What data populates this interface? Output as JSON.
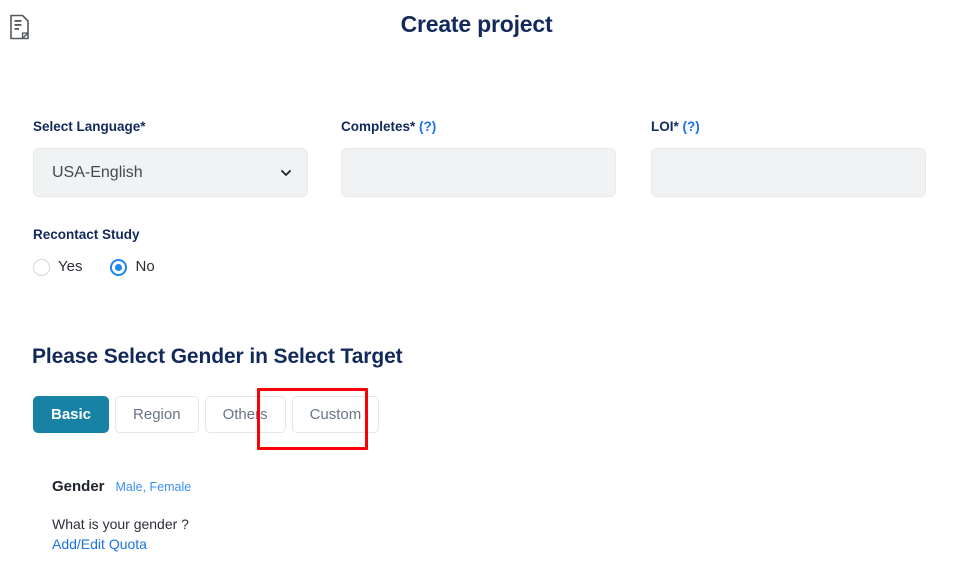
{
  "header": {
    "icon": "document-edit-icon",
    "title": "Create project"
  },
  "form": {
    "language": {
      "label": "Select Language*",
      "value": "USA-English",
      "chevron": "chevron-down-icon"
    },
    "completes": {
      "label": "Completes*",
      "help": "(?)",
      "value": "",
      "placeholder": ""
    },
    "loi": {
      "label": "LOI*",
      "help": "(?)",
      "value": "",
      "placeholder": ""
    },
    "recontact": {
      "label": "Recontact Study",
      "options": [
        {
          "label": "Yes",
          "checked": false
        },
        {
          "label": "No",
          "checked": true
        }
      ]
    }
  },
  "section": {
    "heading": "Please Select Gender in Select Target",
    "tabs": [
      {
        "label": "Basic",
        "active": true
      },
      {
        "label": "Region",
        "active": false
      },
      {
        "label": "Others",
        "active": false
      },
      {
        "label": "Custom",
        "active": false
      }
    ],
    "annotation": {
      "target": "Custom",
      "color": "#fb0007"
    }
  },
  "gender": {
    "title": "Gender",
    "values": "Male, Female",
    "question": "What is your gender ?",
    "quota_link": "Add/Edit Quota"
  },
  "colors": {
    "navy": "#12295b",
    "accent_blue": "#1a73e8",
    "tab_active": "#1782a4",
    "radio_blue": "#1f86f0",
    "field_bg": "#f1f2f3",
    "annotation_red": "#fb0007"
  }
}
